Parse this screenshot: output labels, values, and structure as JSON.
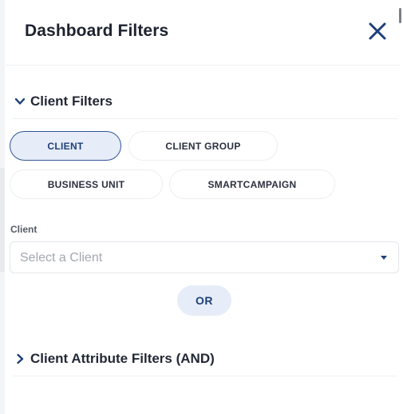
{
  "header": {
    "title": "Dashboard Filters"
  },
  "client_filters": {
    "title": "Client Filters",
    "tabs": [
      {
        "label": "CLIENT",
        "active": true
      },
      {
        "label": "CLIENT GROUP",
        "active": false
      },
      {
        "label": "BUSINESS UNIT",
        "active": false
      },
      {
        "label": "SMARTCAMPAIGN",
        "active": false
      }
    ],
    "field_label": "Client",
    "select_placeholder": "Select a Client",
    "or_label": "OR"
  },
  "attribute_filters": {
    "title": "Client Attribute Filters (AND)"
  },
  "colors": {
    "accent": "#1e3f7a",
    "active_bg": "#e6edf8"
  },
  "icons": {
    "close": "close-icon",
    "expanded": "chevron-down-icon",
    "collapsed": "chevron-right-icon"
  }
}
